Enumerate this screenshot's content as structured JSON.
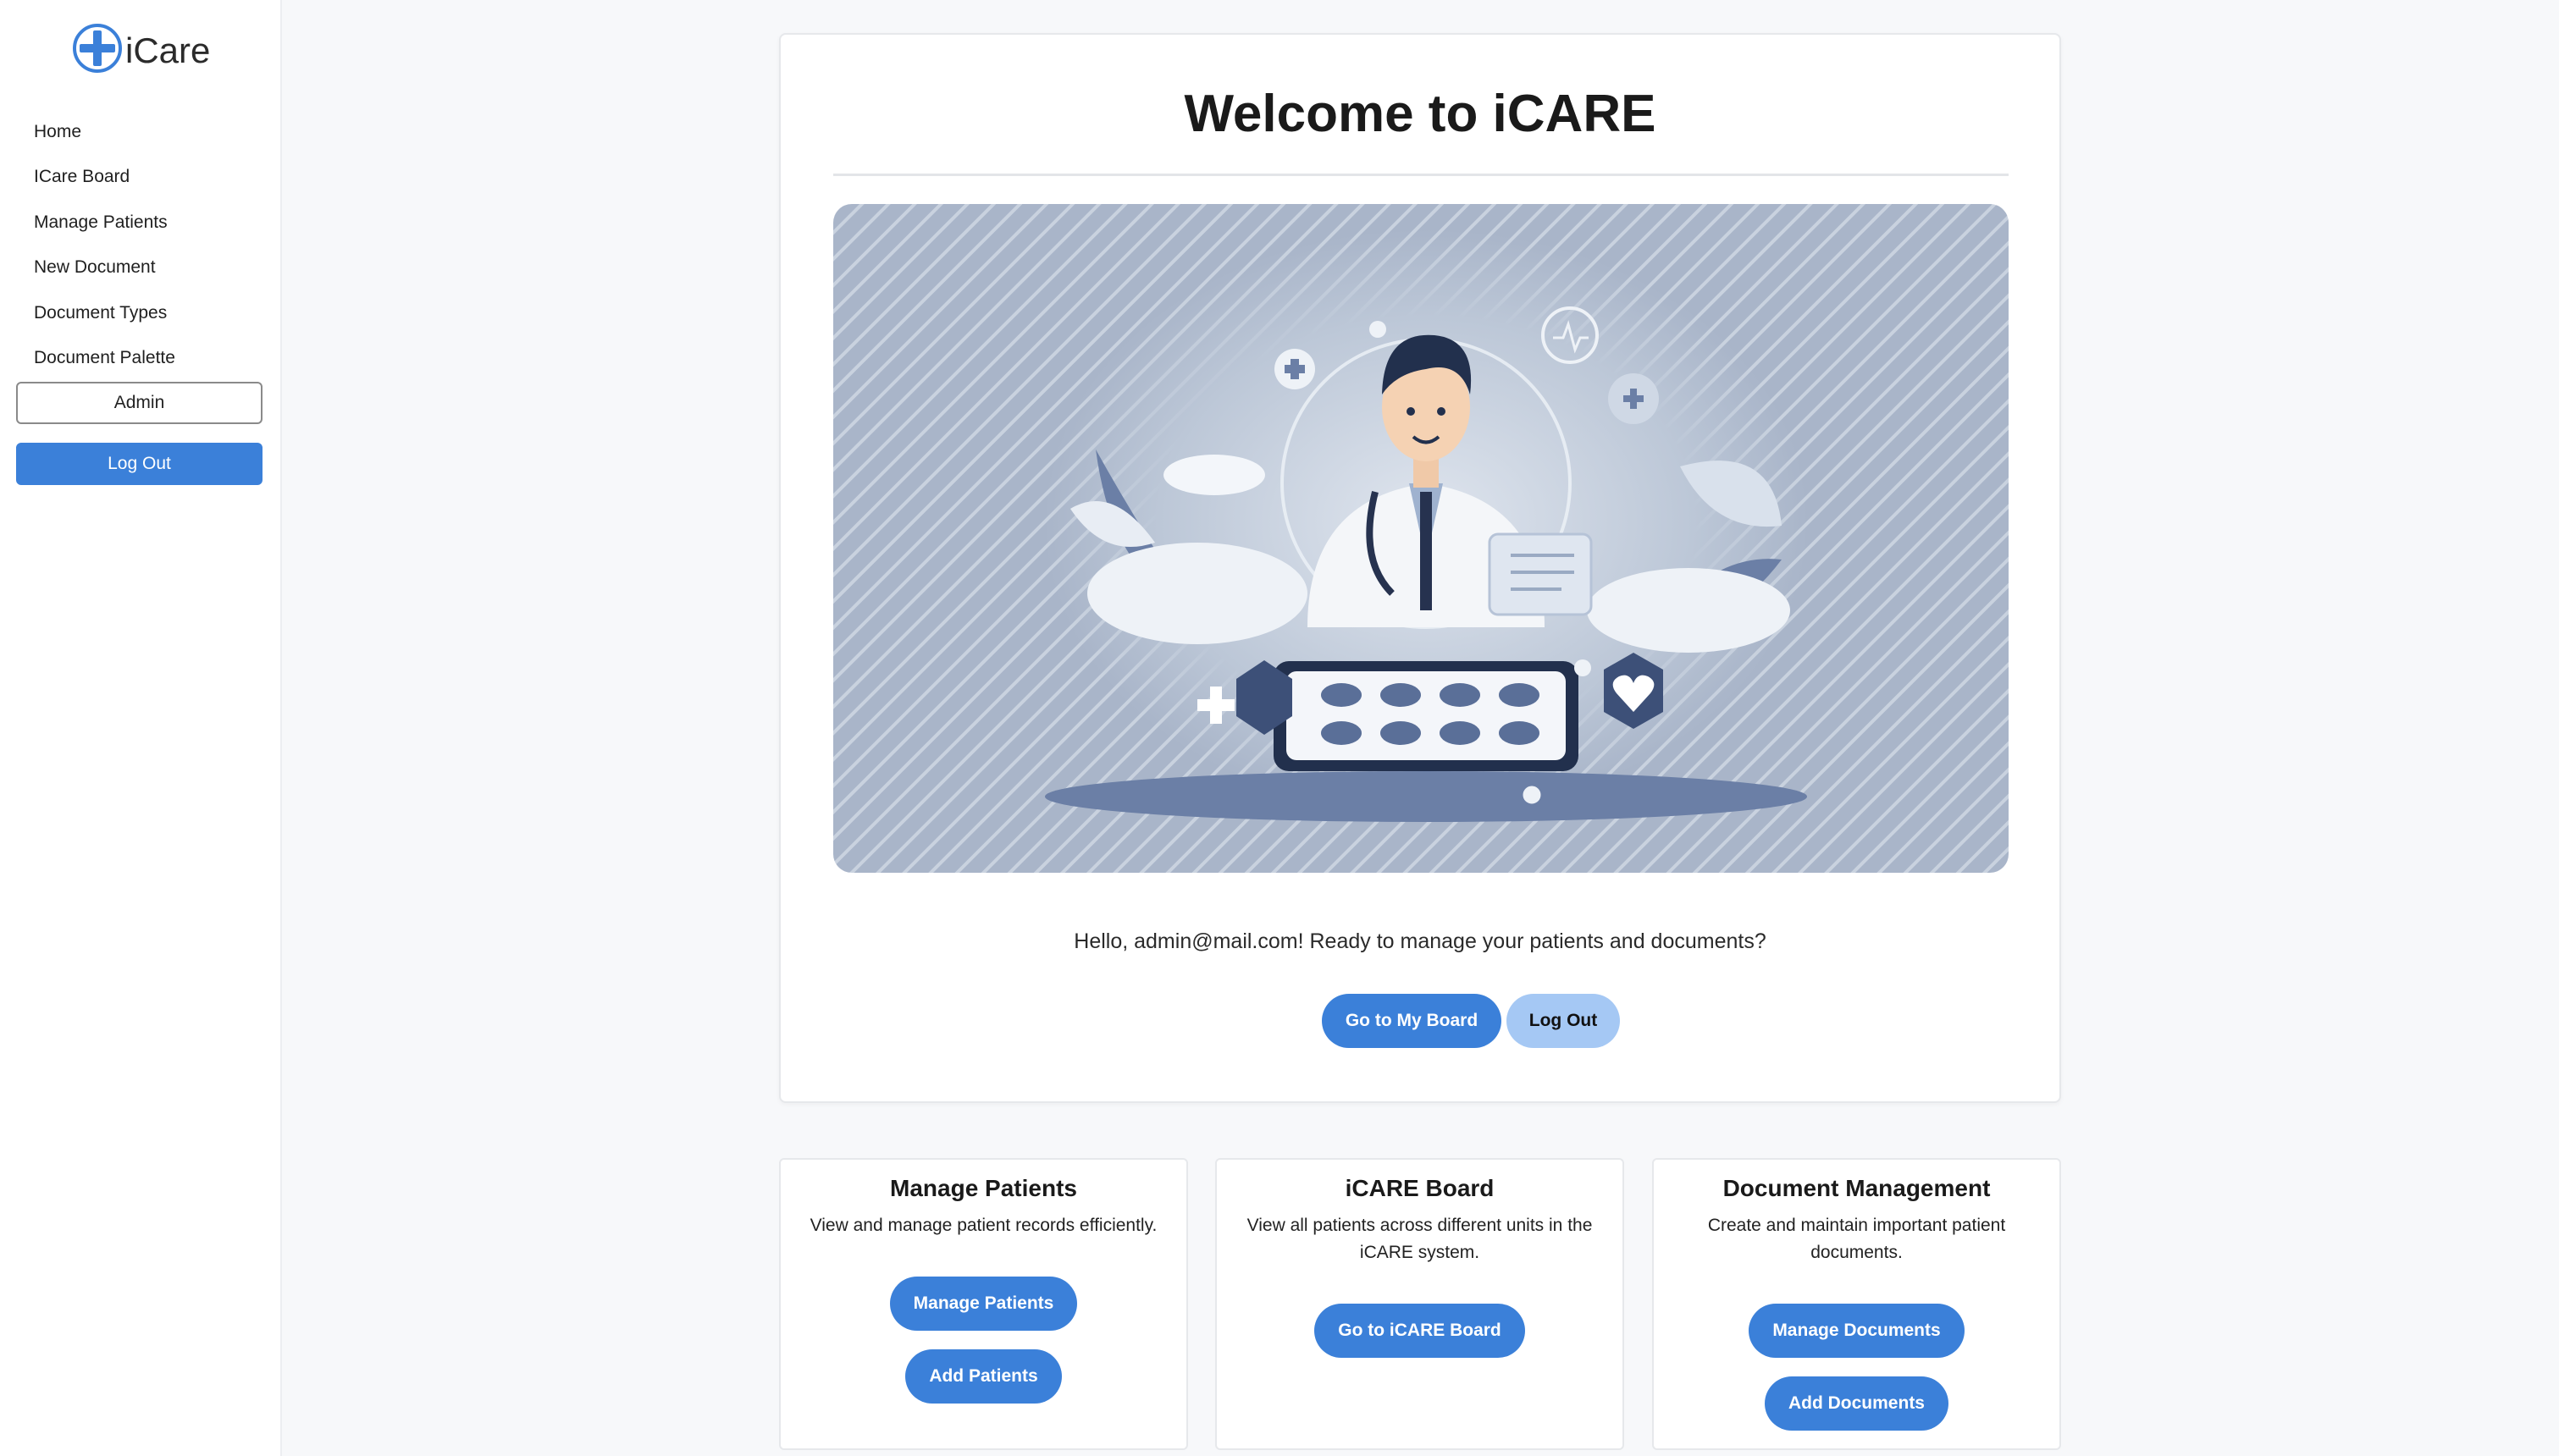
{
  "app": {
    "logo_text": "iCare"
  },
  "sidebar": {
    "items": [
      {
        "label": "Home"
      },
      {
        "label": "ICare Board"
      },
      {
        "label": "Manage Patients"
      },
      {
        "label": "New Document"
      },
      {
        "label": "Document Types"
      },
      {
        "label": "Document Palette"
      }
    ],
    "admin_label": "Admin",
    "logout_label": "Log Out"
  },
  "main": {
    "title": "Welcome to iCARE",
    "greeting": "Hello, admin@mail.com! Ready to manage your patients and documents?",
    "board_button": "Go to My Board",
    "logout_button": "Log Out"
  },
  "features": [
    {
      "title": "Manage Patients",
      "description": "View and manage patient records efficiently.",
      "buttons": [
        "Manage Patients",
        "Add Patients"
      ]
    },
    {
      "title": "iCARE Board",
      "description": "View all patients across different units in the iCARE system.",
      "buttons": [
        "Go to iCARE Board"
      ]
    },
    {
      "title": "Document Management",
      "description": "Create and maintain important patient documents.",
      "buttons": [
        "Manage Documents",
        "Add Documents"
      ]
    }
  ],
  "colors": {
    "primary": "#3b80d9",
    "primary_light": "#a5c8f4",
    "background": "#f7f8fa"
  }
}
